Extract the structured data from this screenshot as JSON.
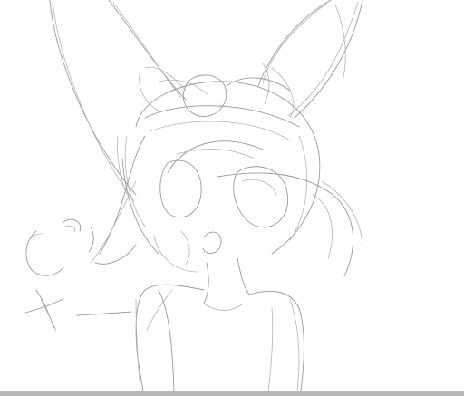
{
  "canvas": {
    "background": "#ffffff",
    "stroke_color": "#9a9a9a",
    "content": "pencil-sketch"
  },
  "bottom_bar": {
    "color": "#b8b8b8"
  }
}
